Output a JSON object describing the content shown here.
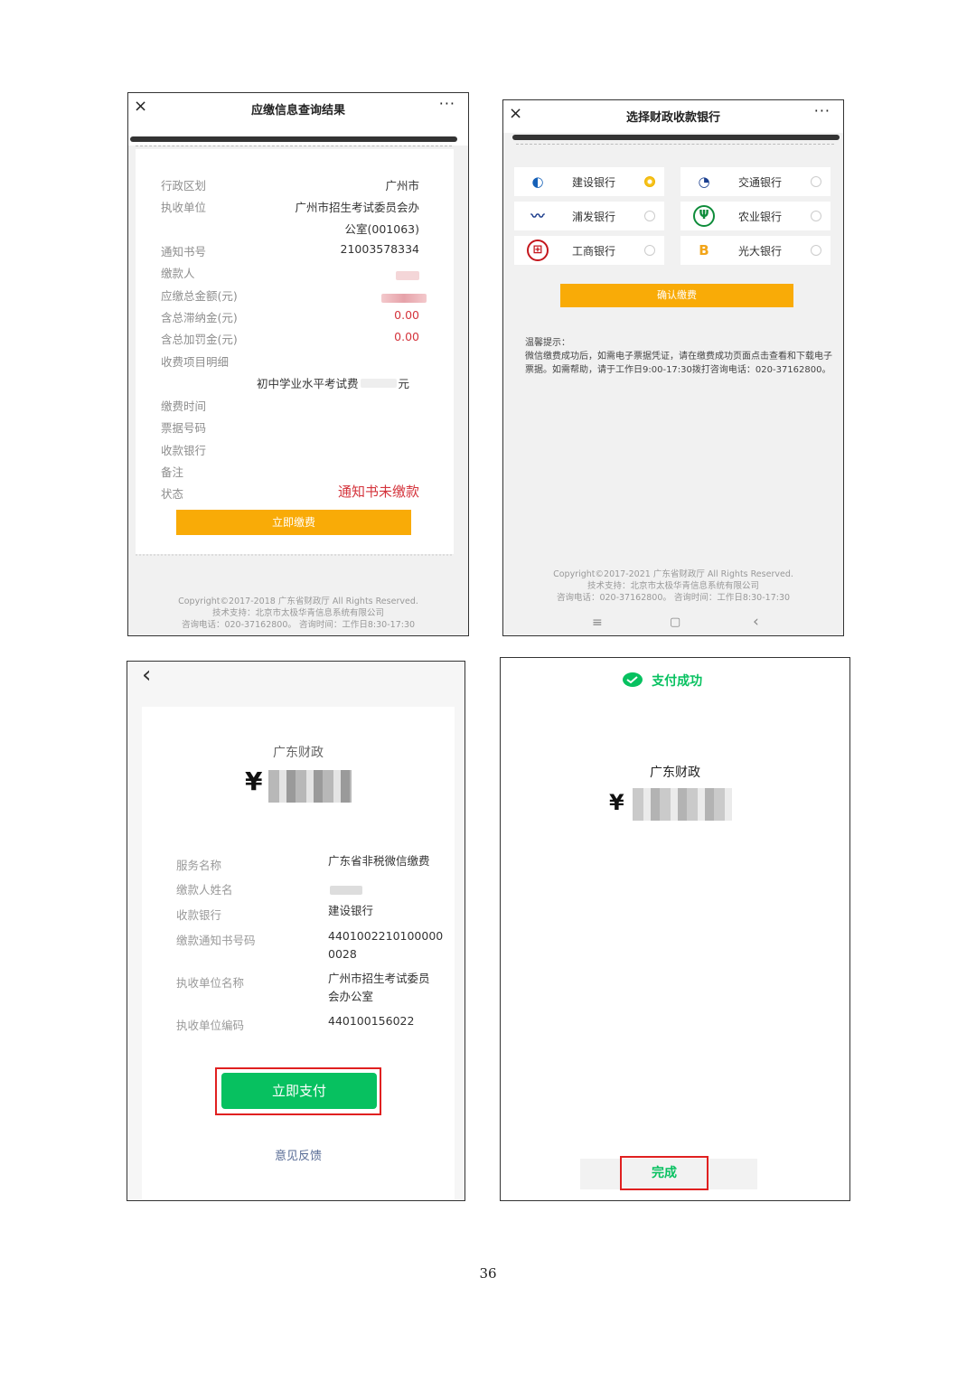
{
  "panel1": {
    "title": "应缴信息查询结果",
    "close": "×",
    "more": "···",
    "rows": [
      {
        "label": "行政区划",
        "value": "广州市"
      },
      {
        "label": "执收单位",
        "value": "广州市招生考试委员会办",
        "value2": "公室(001063)"
      },
      {
        "label": "通知书号",
        "value": "21003578334"
      },
      {
        "label": "缴款人",
        "value": ""
      },
      {
        "label": "应缴总金额(元)",
        "value": ""
      },
      {
        "label": "含总滞纳金(元)",
        "value": "0.00"
      },
      {
        "label": "含总加罚金(元)",
        "value": "0.00"
      },
      {
        "label": "收费项目明细",
        "value": ""
      },
      {
        "label": "缴费时间",
        "value": ""
      },
      {
        "label": "票据号码",
        "value": ""
      },
      {
        "label": "收款银行",
        "value": ""
      },
      {
        "label": "备注",
        "value": ""
      },
      {
        "label": "状态",
        "value": "通知书未缴款"
      }
    ],
    "fee_item": "初中学业水平考试费",
    "fee_unit": "元",
    "pay_button": "立即缴费",
    "footer": [
      "Copyright©2017-2018 广东省财政厅 All Rights Reserved.",
      "技术支持：北京市太极华青信息系统有限公司",
      "咨询电话：020-37162800。 咨询时间：工作日8:30-17:30"
    ]
  },
  "panel2": {
    "title": "选择财政收款银行",
    "close": "×",
    "more": "···",
    "banks": [
      {
        "name": "建设银行",
        "selected": true,
        "color": "#1560b7",
        "glyph": "◐"
      },
      {
        "name": "交通银行",
        "selected": false,
        "color": "#1b3f8f",
        "glyph": "◔"
      },
      {
        "name": "浦发银行",
        "selected": false,
        "color": "#1d3d8c",
        "glyph": "〰"
      },
      {
        "name": "农业银行",
        "selected": false,
        "color": "#0e8c3a",
        "glyph": "Ψ"
      },
      {
        "name": "工商银行",
        "selected": false,
        "color": "#c4161c",
        "glyph": "⊞"
      },
      {
        "name": "光大银行",
        "selected": false,
        "color": "#f2a51a",
        "glyph": "B"
      }
    ],
    "confirm_button": "确认缴费",
    "tip_title": "温馨提示：",
    "tip_text": "微信缴费成功后，如需电子票据凭证，请在缴费成功页面点击查看和下载电子票据。如需帮助，请于工作日9:00-17:30拨打咨询电话：020-37162800。",
    "footer": [
      "Copyright©2017-2021 广东省财政厅 All Rights Reserved.",
      "技术支持：北京市太极华青信息系统有限公司",
      "咨询电话：020-37162800。 咨询时间：工作日8:30-17:30"
    ],
    "nav": {
      "menu": "≡",
      "home": "▢",
      "back": "‹"
    }
  },
  "panel3": {
    "back": "‹",
    "merchant": "广东财政",
    "currency": "¥",
    "rows": [
      {
        "label": "服务名称",
        "value": "广东省非税微信缴费"
      },
      {
        "label": "缴款人姓名",
        "value": ""
      },
      {
        "label": "收款银行",
        "value": "建设银行"
      },
      {
        "label": "缴款通知书号码",
        "value": "4401002210100000 0028"
      },
      {
        "label": "执收单位名称",
        "value": "广州市招生考试委员会办公室"
      },
      {
        "label": "执收单位编码",
        "value": "440100156022"
      }
    ],
    "pay_button": "立即支付",
    "feedback": "意见反馈",
    "accent": "#07c160"
  },
  "panel4": {
    "status": "支付成功",
    "merchant": "广东财政",
    "currency": "¥",
    "done_button": "完成"
  },
  "page_number": "36"
}
